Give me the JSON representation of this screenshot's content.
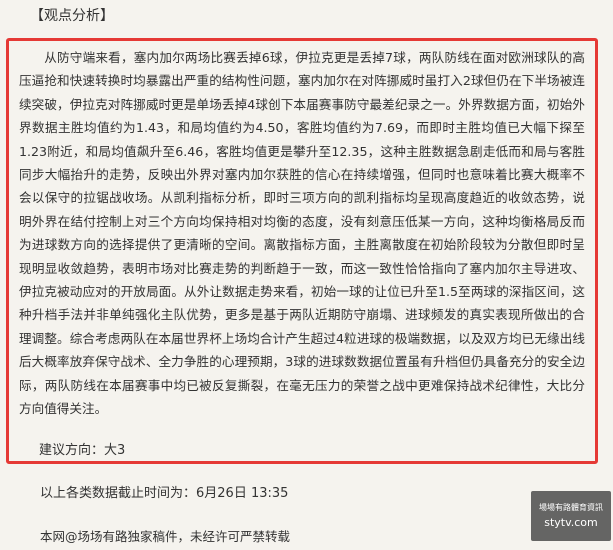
{
  "section": {
    "title": "【观点分析】"
  },
  "analysis": {
    "body": "从防守端来看，塞内加尔两场比赛丢掉6球，伊拉克更是丢掉7球，两队防线在面对欧洲球队的高压逼抢和快速转换时均暴露出严重的结构性问题，塞内加尔在对阵挪威时虽打入2球但仍在下半场被连续突破，伊拉克对阵挪威时更是单场丢掉4球创下本届赛事防守最差纪录之一。外界数据方面，初始外界数据主胜均值约为1.43，和局均值约为4.50，客胜均值约为7.69，而即时主胜均值已大幅下探至1.23附近，和局均值飙升至6.46，客胜均值更是攀升至12.35，这种主胜数据急剧走低而和局与客胜同步大幅抬升的走势，反映出外界对塞内加尔获胜的信心在持续增强，但同时也意味着比赛大概率不会以保守的拉锯战收场。从凯利指标分析，即时三项方向的凯利指标均呈现高度趋近的收敛态势，说明外界在结付控制上对三个方向均保持相对均衡的态度，没有刻意压低某一方向，这种均衡格局反而为进球数方向的选择提供了更清晰的空间。离散指标方面，主胜离散度在初始阶段较为分散但即时呈现明显收敛趋势，表明市场对比赛走势的判断趋于一致，而这一致性恰恰指向了塞内加尔主导进攻、伊拉克被动应对的开放局面。从外让数据走势来看，初始一球的让位已升至1.5至两球的深指区间，这种升档手法并非单纯强化主队优势，更多是基于两队近期防守崩塌、进球频发的真实表现所做出的合理调整。综合考虑两队在本届世界杯上场均合计产生超过4粒进球的极端数据，以及双方均已无缘出线后大概率放弃保守战术、全力争胜的心理预期，3球的进球数数据位置虽有升档但仍具备充分的安全边际，两队防线在本届赛事中均已被反复撕裂，在毫无压力的荣誉之战中更难保持战术纪律性，大比分方向值得关注。",
    "advice": "建议方向：大3"
  },
  "footer": {
    "cutoff": "以上各类数据截止时间为：6月26日 13:35",
    "copyright": "本网@场场有路独家稿件，未经许可严禁转载"
  },
  "watermark": {
    "top_text": "場場有路體育資訊",
    "domain": "stytv.com"
  },
  "colors": {
    "border": "#e53935",
    "background": "#f5f3ee",
    "text": "#333333"
  }
}
